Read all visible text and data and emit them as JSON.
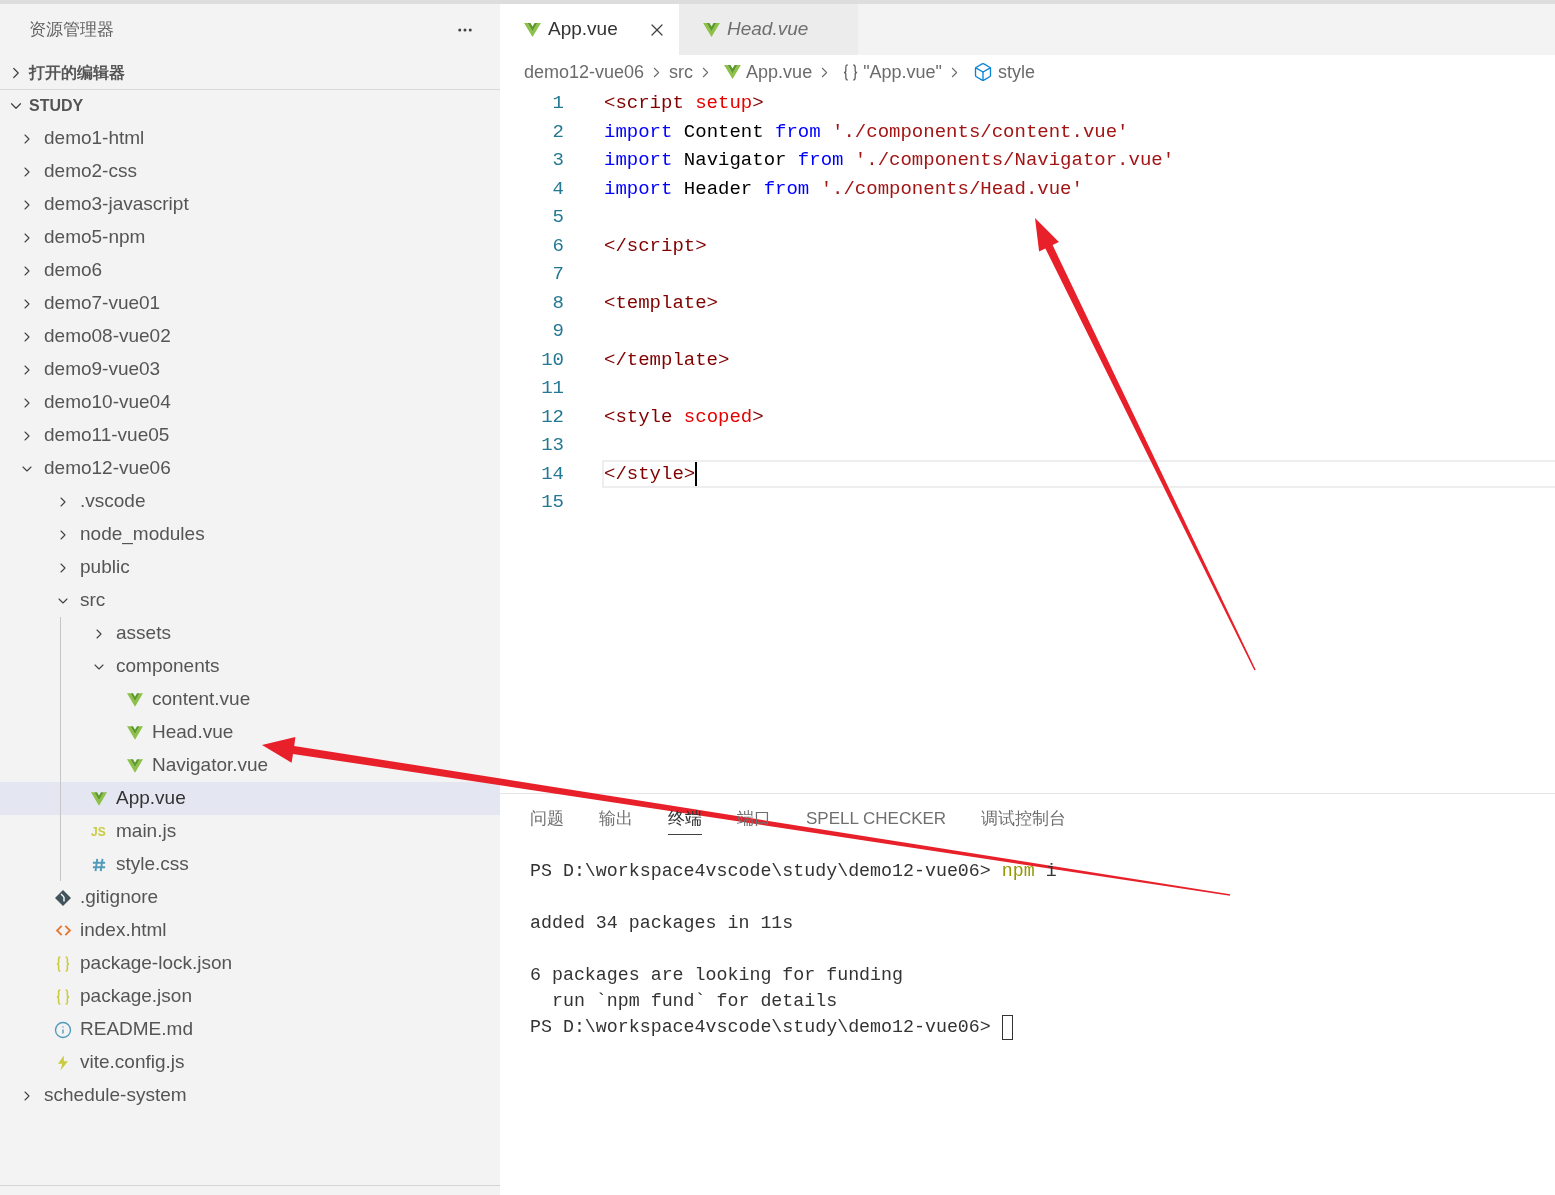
{
  "explorer": {
    "title": "资源管理器",
    "sections": [
      {
        "label": "打开的编辑器",
        "expanded": false
      },
      {
        "label": "STUDY",
        "expanded": true,
        "children": [
          {
            "name": "demo1-html",
            "kind": "folder",
            "expanded": false,
            "selected": false
          },
          {
            "name": "demo2-css",
            "kind": "folder",
            "expanded": false,
            "selected": false
          },
          {
            "name": "demo3-javascript",
            "kind": "folder",
            "expanded": false,
            "selected": false
          },
          {
            "name": "demo5-npm",
            "kind": "folder",
            "expanded": false,
            "selected": false
          },
          {
            "name": "demo6",
            "kind": "folder",
            "expanded": false,
            "selected": false
          },
          {
            "name": "demo7-vue01",
            "kind": "folder",
            "expanded": false,
            "selected": false
          },
          {
            "name": "demo08-vue02",
            "kind": "folder",
            "expanded": false,
            "selected": false
          },
          {
            "name": "demo9-vue03",
            "kind": "folder",
            "expanded": false,
            "selected": false
          },
          {
            "name": "demo10-vue04",
            "kind": "folder",
            "expanded": false,
            "selected": false
          },
          {
            "name": "demo11-vue05",
            "kind": "folder",
            "expanded": false,
            "selected": false
          },
          {
            "name": "demo12-vue06",
            "kind": "folder",
            "expanded": true,
            "selected": false,
            "children": [
              {
                "name": ".vscode",
                "kind": "folder",
                "expanded": false,
                "selected": false
              },
              {
                "name": "node_modules",
                "kind": "folder",
                "expanded": false,
                "selected": false
              },
              {
                "name": "public",
                "kind": "folder",
                "expanded": false,
                "selected": false
              },
              {
                "name": "src",
                "kind": "folder",
                "expanded": true,
                "selected": false,
                "children": [
                  {
                    "name": "assets",
                    "kind": "folder",
                    "expanded": false,
                    "selected": false
                  },
                  {
                    "name": "components",
                    "kind": "folder",
                    "expanded": true,
                    "selected": false,
                    "children": [
                      {
                        "name": "content.vue",
                        "kind": "vue",
                        "selected": false
                      },
                      {
                        "name": "Head.vue",
                        "kind": "vue",
                        "selected": false
                      },
                      {
                        "name": "Navigator.vue",
                        "kind": "vue",
                        "selected": false
                      }
                    ]
                  },
                  {
                    "name": "App.vue",
                    "kind": "vue",
                    "selected": true
                  },
                  {
                    "name": "main.js",
                    "kind": "js",
                    "icon_label": "JS",
                    "selected": false
                  },
                  {
                    "name": "style.css",
                    "kind": "css",
                    "selected": false
                  }
                ]
              },
              {
                "name": ".gitignore",
                "kind": "git",
                "selected": false
              },
              {
                "name": "index.html",
                "kind": "html",
                "selected": false
              },
              {
                "name": "package-lock.json",
                "kind": "json",
                "selected": false
              },
              {
                "name": "package.json",
                "kind": "json",
                "selected": false
              },
              {
                "name": "README.md",
                "kind": "info",
                "selected": false
              },
              {
                "name": "vite.config.js",
                "kind": "vite",
                "selected": false
              }
            ]
          },
          {
            "name": "schedule-system",
            "kind": "folder",
            "expanded": false,
            "selected": false
          }
        ]
      }
    ]
  },
  "editor": {
    "tabs": [
      {
        "label": "App.vue",
        "kind": "vue",
        "selected": true,
        "preview": false
      },
      {
        "label": "Head.vue",
        "kind": "vue",
        "selected": false,
        "preview": true
      }
    ],
    "breadcrumb": [
      {
        "label": "demo12-vue06",
        "kind": "folder"
      },
      {
        "label": "src",
        "kind": "folder"
      },
      {
        "label": "App.vue",
        "kind": "vue"
      },
      {
        "label": "\"App.vue\"",
        "kind": "object"
      },
      {
        "label": "style",
        "kind": "module"
      }
    ],
    "lines": [
      {
        "number": "1",
        "current": false,
        "tokens": [
          {
            "text": "<script ",
            "kind": "tag"
          },
          {
            "text": "setup",
            "kind": "attr"
          },
          {
            "text": ">",
            "kind": "tag"
          }
        ]
      },
      {
        "number": "2",
        "current": false,
        "tokens": [
          {
            "text": "import",
            "kind": "keyword"
          },
          {
            "text": " Content ",
            "kind": "plain"
          },
          {
            "text": "from",
            "kind": "keyword"
          },
          {
            "text": " './components/content.vue'",
            "kind": "string"
          }
        ]
      },
      {
        "number": "3",
        "current": false,
        "tokens": [
          {
            "text": "import",
            "kind": "keyword"
          },
          {
            "text": " Navigator ",
            "kind": "plain"
          },
          {
            "text": "from",
            "kind": "keyword"
          },
          {
            "text": " './components/Navigator.vue'",
            "kind": "string"
          }
        ]
      },
      {
        "number": "4",
        "current": false,
        "tokens": [
          {
            "text": "import",
            "kind": "keyword"
          },
          {
            "text": " Header ",
            "kind": "plain"
          },
          {
            "text": "from",
            "kind": "keyword"
          },
          {
            "text": " './components/Head.vue'",
            "kind": "string"
          }
        ]
      },
      {
        "number": "5",
        "current": false
      },
      {
        "number": "6",
        "current": false,
        "tokens": [
          {
            "text": "</script>",
            "kind": "tag"
          }
        ]
      },
      {
        "number": "7",
        "current": false
      },
      {
        "number": "8",
        "current": false,
        "tokens": [
          {
            "text": "<template>",
            "kind": "tag"
          }
        ]
      },
      {
        "number": "9",
        "current": false
      },
      {
        "number": "10",
        "current": false,
        "tokens": [
          {
            "text": "</template>",
            "kind": "tag"
          }
        ]
      },
      {
        "number": "11",
        "current": false
      },
      {
        "number": "12",
        "current": false,
        "tokens": [
          {
            "text": "<style ",
            "kind": "tag"
          },
          {
            "text": "scoped",
            "kind": "attr"
          },
          {
            "text": ">",
            "kind": "tag"
          }
        ]
      },
      {
        "number": "13",
        "current": false
      },
      {
        "number": "14",
        "current": true,
        "tokens": [
          {
            "text": "</style>",
            "kind": "tag"
          }
        ]
      },
      {
        "number": "15",
        "current": false
      }
    ]
  },
  "panel": {
    "tabs": [
      {
        "label": "问题",
        "selected": false
      },
      {
        "label": "输出",
        "selected": false
      },
      {
        "label": "终端",
        "selected": true
      },
      {
        "label": "端口",
        "selected": false
      },
      {
        "label": "SPELL CHECKER",
        "selected": false
      },
      {
        "label": "调试控制台",
        "selected": false
      }
    ],
    "terminal": {
      "cursor": true,
      "lines": [
        {
          "kind": "text",
          "segments": [
            {
              "text": "PS D:\\workspace4vscode\\study\\demo12-vue06> ",
              "kind": "plain"
            },
            {
              "text": "npm",
              "kind": "command"
            },
            {
              "text": " i",
              "kind": "plain"
            }
          ]
        },
        {
          "kind": "blank"
        },
        {
          "kind": "text",
          "segments": [
            {
              "text": "added 34 packages in 11s",
              "kind": "plain"
            }
          ]
        },
        {
          "kind": "blank"
        },
        {
          "kind": "text",
          "segments": [
            {
              "text": "6 packages are looking for funding",
              "kind": "plain"
            }
          ]
        },
        {
          "kind": "text",
          "segments": [
            {
              "text": "  run `npm fund` for details",
              "kind": "plain"
            }
          ]
        },
        {
          "kind": "text",
          "segments": [
            {
              "text": "PS D:\\workspace4vscode\\study\\demo12-vue06> ",
              "kind": "plain"
            }
          ]
        }
      ]
    }
  }
}
